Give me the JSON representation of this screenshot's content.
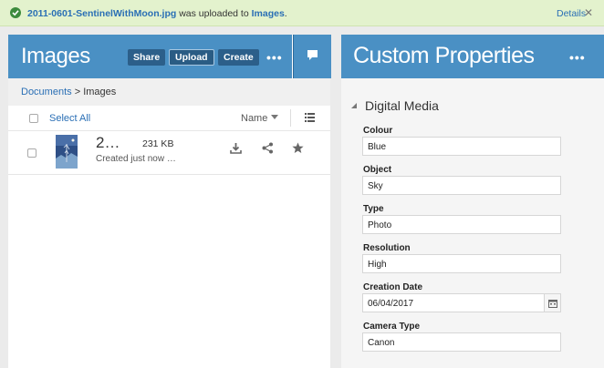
{
  "notification": {
    "file_link": "2011-0601-SentinelWithMoon.jpg",
    "middle_text": "was uploaded to",
    "folder_link": "Images",
    "period": ".",
    "details_label": "Details",
    "close_glyph": "✕",
    "status_color": "#3d8b3d"
  },
  "images_panel": {
    "title": "Images",
    "buttons": {
      "share": "Share",
      "upload": "Upload",
      "create": "Create"
    },
    "more_glyph": "•••",
    "breadcrumb": {
      "root": "Documents",
      "separator": ">",
      "current": "Images"
    },
    "toolbar": {
      "select_all": "Select All",
      "sort_label": "Name"
    },
    "files": [
      {
        "name": "2…",
        "size": "231 KB",
        "modified": "Created just now …"
      }
    ],
    "header_color": "#4a90c4"
  },
  "properties_panel": {
    "title": "Custom Properties",
    "more_glyph": "•••",
    "section": "Digital Media",
    "fields": [
      {
        "label": "Colour",
        "value": "Blue"
      },
      {
        "label": "Object",
        "value": "Sky"
      },
      {
        "label": "Type",
        "value": "Photo"
      },
      {
        "label": "Resolution",
        "value": "High"
      },
      {
        "label": "Creation Date",
        "value": "06/04/2017"
      },
      {
        "label": "Camera Type",
        "value": "Canon"
      }
    ]
  },
  "icons": [
    "check-circle-icon",
    "close-icon",
    "comment-icon",
    "list-view-icon",
    "download-icon",
    "share-icon",
    "star-icon",
    "calendar-icon",
    "caret-down-icon",
    "collapse-triangle-icon"
  ]
}
